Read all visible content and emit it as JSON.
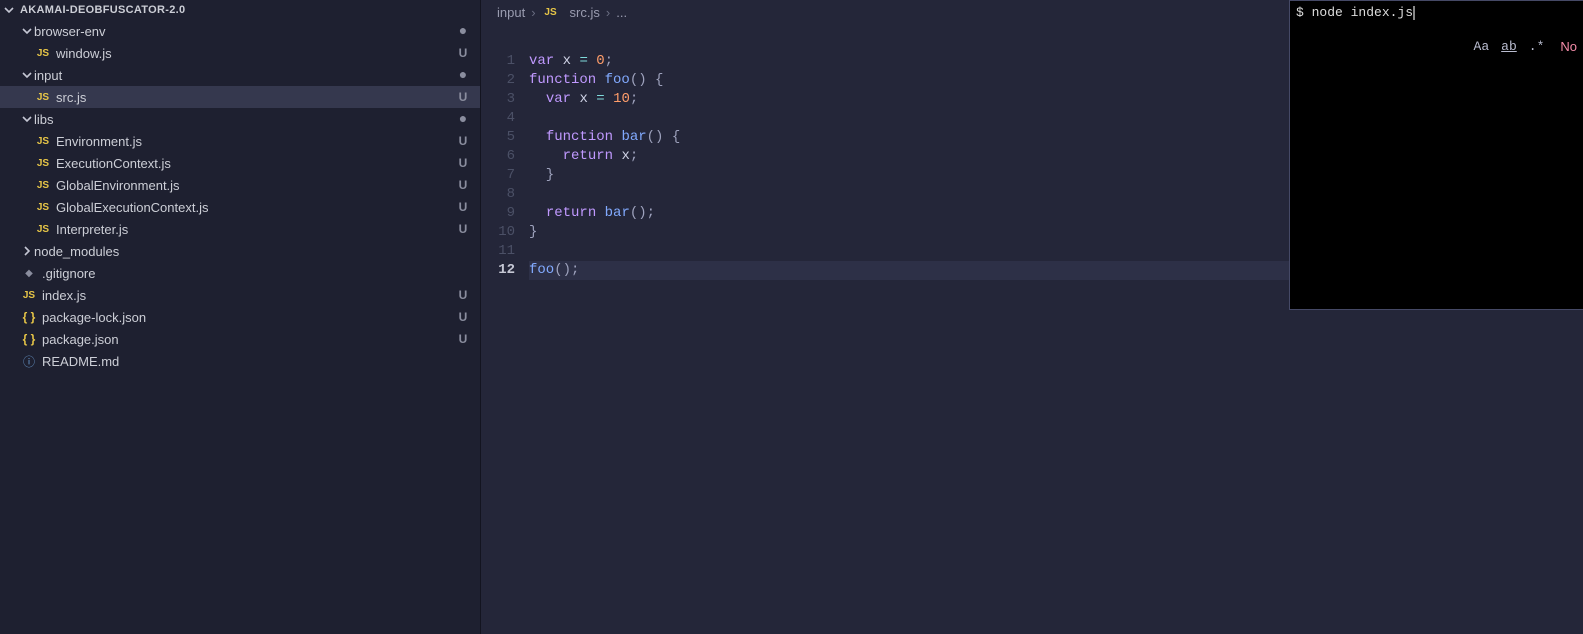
{
  "explorer": {
    "root": "AKAMAI-DEOBFUSCATOR-2.0",
    "items": [
      {
        "type": "folder",
        "name": "browser-env",
        "indent": 1,
        "open": true,
        "status": "dot"
      },
      {
        "type": "file",
        "name": "window.js",
        "indent": 2,
        "icon": "js",
        "status": "U"
      },
      {
        "type": "folder",
        "name": "input",
        "indent": 1,
        "open": true,
        "status": "dot"
      },
      {
        "type": "file",
        "name": "src.js",
        "indent": 2,
        "icon": "js",
        "status": "U",
        "active": true
      },
      {
        "type": "folder",
        "name": "libs",
        "indent": 1,
        "open": true,
        "status": "dot"
      },
      {
        "type": "file",
        "name": "Environment.js",
        "indent": 2,
        "icon": "js",
        "status": "U"
      },
      {
        "type": "file",
        "name": "ExecutionContext.js",
        "indent": 2,
        "icon": "js",
        "status": "U"
      },
      {
        "type": "file",
        "name": "GlobalEnvironment.js",
        "indent": 2,
        "icon": "js",
        "status": "U"
      },
      {
        "type": "file",
        "name": "GlobalExecutionContext.js",
        "indent": 2,
        "icon": "js",
        "status": "U"
      },
      {
        "type": "file",
        "name": "Interpreter.js",
        "indent": 2,
        "icon": "js",
        "status": "U"
      },
      {
        "type": "folder",
        "name": "node_modules",
        "indent": 1,
        "open": false,
        "status": ""
      },
      {
        "type": "file",
        "name": ".gitignore",
        "indent": 1,
        "icon": "diamond",
        "status": ""
      },
      {
        "type": "file",
        "name": "index.js",
        "indent": 1,
        "icon": "js",
        "status": "U"
      },
      {
        "type": "file",
        "name": "package-lock.json",
        "indent": 1,
        "icon": "json",
        "status": "U"
      },
      {
        "type": "file",
        "name": "package.json",
        "indent": 1,
        "icon": "json",
        "status": "U"
      },
      {
        "type": "file",
        "name": "README.md",
        "indent": 1,
        "icon": "info",
        "status": ""
      }
    ]
  },
  "breadcrumb": {
    "part1": "input",
    "part2": "src.js",
    "part3": "..."
  },
  "icons": {
    "js": "JS",
    "json": "{ }",
    "info": "ⓘ",
    "diamond": "◆"
  },
  "code": {
    "lines": [
      {
        "n": 1,
        "tokens": [
          [
            "kw",
            "var"
          ],
          [
            "pn",
            " "
          ],
          [
            "id",
            "x"
          ],
          [
            "pn",
            " "
          ],
          [
            "op",
            "="
          ],
          [
            "pn",
            " "
          ],
          [
            "num",
            "0"
          ],
          [
            "pn",
            ";"
          ]
        ]
      },
      {
        "n": 2,
        "tokens": [
          [
            "kw",
            "function"
          ],
          [
            "pn",
            " "
          ],
          [
            "fn",
            "foo"
          ],
          [
            "pn",
            "() {"
          ]
        ]
      },
      {
        "n": 3,
        "tokens": [
          [
            "pn",
            "  "
          ],
          [
            "kw",
            "var"
          ],
          [
            "pn",
            " "
          ],
          [
            "id",
            "x"
          ],
          [
            "pn",
            " "
          ],
          [
            "op",
            "="
          ],
          [
            "pn",
            " "
          ],
          [
            "num",
            "10"
          ],
          [
            "pn",
            ";"
          ]
        ]
      },
      {
        "n": 4,
        "tokens": []
      },
      {
        "n": 5,
        "tokens": [
          [
            "pn",
            "  "
          ],
          [
            "kw",
            "function"
          ],
          [
            "pn",
            " "
          ],
          [
            "fn",
            "bar"
          ],
          [
            "pn",
            "() {"
          ]
        ]
      },
      {
        "n": 6,
        "tokens": [
          [
            "pn",
            "    "
          ],
          [
            "kw",
            "return"
          ],
          [
            "pn",
            " "
          ],
          [
            "id",
            "x"
          ],
          [
            "pn",
            ";"
          ]
        ]
      },
      {
        "n": 7,
        "tokens": [
          [
            "pn",
            "  }"
          ]
        ]
      },
      {
        "n": 8,
        "tokens": []
      },
      {
        "n": 9,
        "tokens": [
          [
            "pn",
            "  "
          ],
          [
            "kw",
            "return"
          ],
          [
            "pn",
            " "
          ],
          [
            "fn",
            "bar"
          ],
          [
            "pn",
            "();"
          ]
        ]
      },
      {
        "n": 10,
        "tokens": [
          [
            "pn",
            "}"
          ]
        ]
      },
      {
        "n": 11,
        "tokens": []
      },
      {
        "n": 12,
        "tokens": [
          [
            "fn",
            "foo"
          ],
          [
            "pn",
            "();"
          ]
        ],
        "active": true
      }
    ]
  },
  "terminal": {
    "prompt": "$ ",
    "command": "node index.js"
  },
  "search": {
    "case": "Aa",
    "word": "ab",
    "regex": ".*",
    "noresults_prefix": "No "
  }
}
